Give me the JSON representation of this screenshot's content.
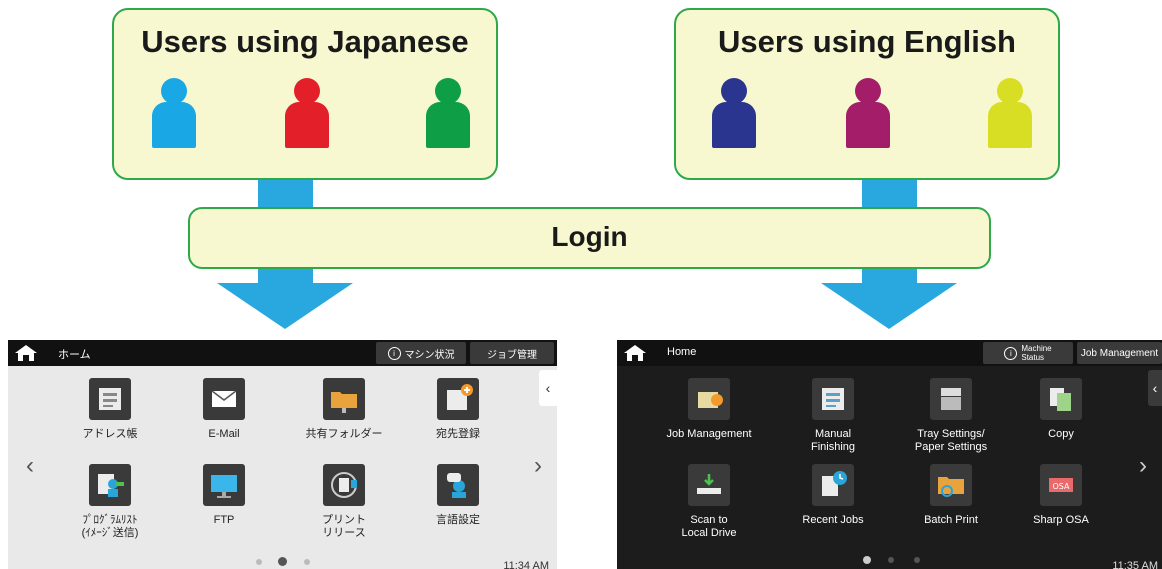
{
  "groups": {
    "japanese": {
      "title": "Users using Japanese",
      "person_colors": [
        "#1aa7e6",
        "#e3202a",
        "#0e9e45"
      ]
    },
    "english": {
      "title": "Users using English",
      "person_colors": [
        "#2a3590",
        "#a31d69",
        "#d8de24"
      ]
    }
  },
  "login": {
    "label": "Login"
  },
  "colors": {
    "box_fill": "#f7f8d0",
    "box_border": "#2fa84a",
    "arrow": "#29a8e0"
  },
  "jp_panel": {
    "home_title": "ホーム",
    "machine_status": "マシン状況",
    "job_management": "ジョブ管理",
    "tiles": [
      {
        "label": "アドレス帳",
        "icon": "address-book-icon"
      },
      {
        "label": "E-Mail",
        "icon": "email-icon"
      },
      {
        "label": "共有フォルダー",
        "icon": "shared-folder-icon"
      },
      {
        "label": "宛先登録",
        "icon": "destination-register-icon"
      },
      {
        "label": "ﾌﾟﾛｸﾞﾗﾑﾘｽﾄ\n(ｲﾒｰｼﾞ送信)",
        "icon": "program-list-icon"
      },
      {
        "label": "FTP",
        "icon": "ftp-icon"
      },
      {
        "label": "プリント\nリリース",
        "icon": "print-release-icon"
      },
      {
        "label": "言語設定",
        "icon": "language-settings-icon"
      }
    ],
    "time": "11:34 AM"
  },
  "en_panel": {
    "home_title": "Home",
    "machine_status": "Machine\nStatus",
    "job_management": "Job Management",
    "tiles": [
      {
        "label": "Job Management",
        "icon": "job-management-icon"
      },
      {
        "label": "Manual\nFinishing",
        "icon": "manual-finishing-icon"
      },
      {
        "label": "Tray Settings/\nPaper Settings",
        "icon": "tray-settings-icon"
      },
      {
        "label": "Copy",
        "icon": "copy-icon"
      },
      {
        "label": "Scan to\nLocal Drive",
        "icon": "scan-to-local-drive-icon"
      },
      {
        "label": "Recent Jobs",
        "icon": "recent-jobs-icon"
      },
      {
        "label": "Batch Print",
        "icon": "batch-print-icon"
      },
      {
        "label": "Sharp OSA",
        "icon": "sharp-osa-icon"
      }
    ],
    "time": "11:35 AM"
  }
}
